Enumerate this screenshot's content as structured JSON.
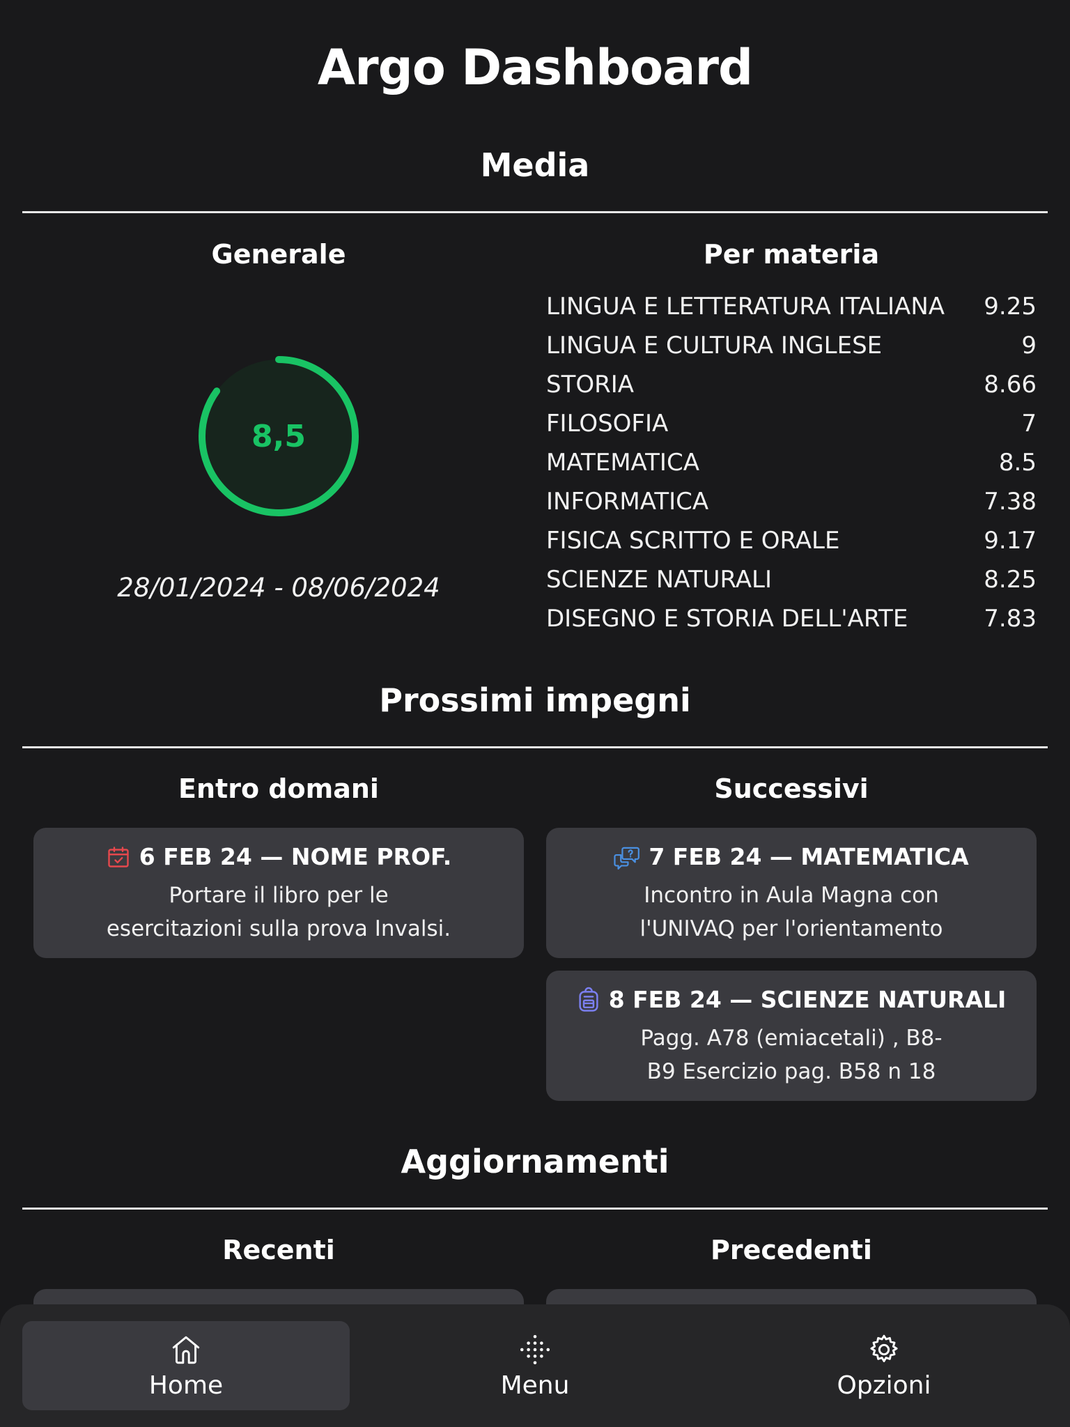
{
  "app": {
    "title": "Argo Dashboard"
  },
  "media": {
    "title": "Media",
    "generale": {
      "title": "Generale",
      "value": "8,5",
      "progress_fraction": 0.85,
      "ring_color": "#19c364",
      "date_range": "28/01/2024 - 08/06/2024"
    },
    "per_materia": {
      "title": "Per materia",
      "subjects": [
        {
          "name": "LINGUA E LETTERATURA ITALIANA",
          "value": "9.25"
        },
        {
          "name": "LINGUA E CULTURA INGLESE",
          "value": "9"
        },
        {
          "name": "STORIA",
          "value": "8.66"
        },
        {
          "name": "FILOSOFIA",
          "value": "7"
        },
        {
          "name": "MATEMATICA",
          "value": "8.5"
        },
        {
          "name": "INFORMATICA",
          "value": "7.38"
        },
        {
          "name": "FISICA SCRITTO E ORALE",
          "value": "9.17"
        },
        {
          "name": "SCIENZE NATURALI",
          "value": "8.25"
        },
        {
          "name": "DISEGNO E STORIA DELL'ARTE",
          "value": "7.83"
        }
      ]
    }
  },
  "impegni": {
    "title": "Prossimi impegni",
    "entro_domani": {
      "title": "Entro domani",
      "items": [
        {
          "icon": "calendar-check-icon",
          "heading": "6 FEB 24 — NOME PROF.",
          "line1": "Portare il libro per le",
          "line2": "esercitazioni sulla prova Invalsi."
        }
      ]
    },
    "successivi": {
      "title": "Successivi",
      "items": [
        {
          "icon": "chat-question-icon",
          "heading": "7 FEB 24 — MATEMATICA",
          "line1": "Incontro in Aula Magna con",
          "line2": "l'UNIVAQ per l'orientamento"
        },
        {
          "icon": "backpack-icon",
          "heading": "8 FEB 24 — SCIENZE NATURALI",
          "line1": "Pagg. A78 (emiacetali) , B8-",
          "line2": "B9 Esercizio pag. B58 n 18"
        }
      ]
    }
  },
  "aggiornamenti": {
    "title": "Aggiornamenti",
    "recenti": {
      "title": "Recenti"
    },
    "precedenti": {
      "title": "Precedenti"
    }
  },
  "nav": {
    "items": [
      {
        "label": "Home",
        "icon": "home-icon",
        "active": true
      },
      {
        "label": "Menu",
        "icon": "dots-grid-icon",
        "active": false
      },
      {
        "label": "Opzioni",
        "icon": "gear-icon",
        "active": false
      }
    ]
  },
  "colors": {
    "background": "#19191b",
    "card": "#3a3a3f",
    "accent_green": "#19c364",
    "calendar_icon": "#e5484d",
    "chat_icon": "#4a90e2",
    "backpack_icon": "#7b7ff0"
  }
}
